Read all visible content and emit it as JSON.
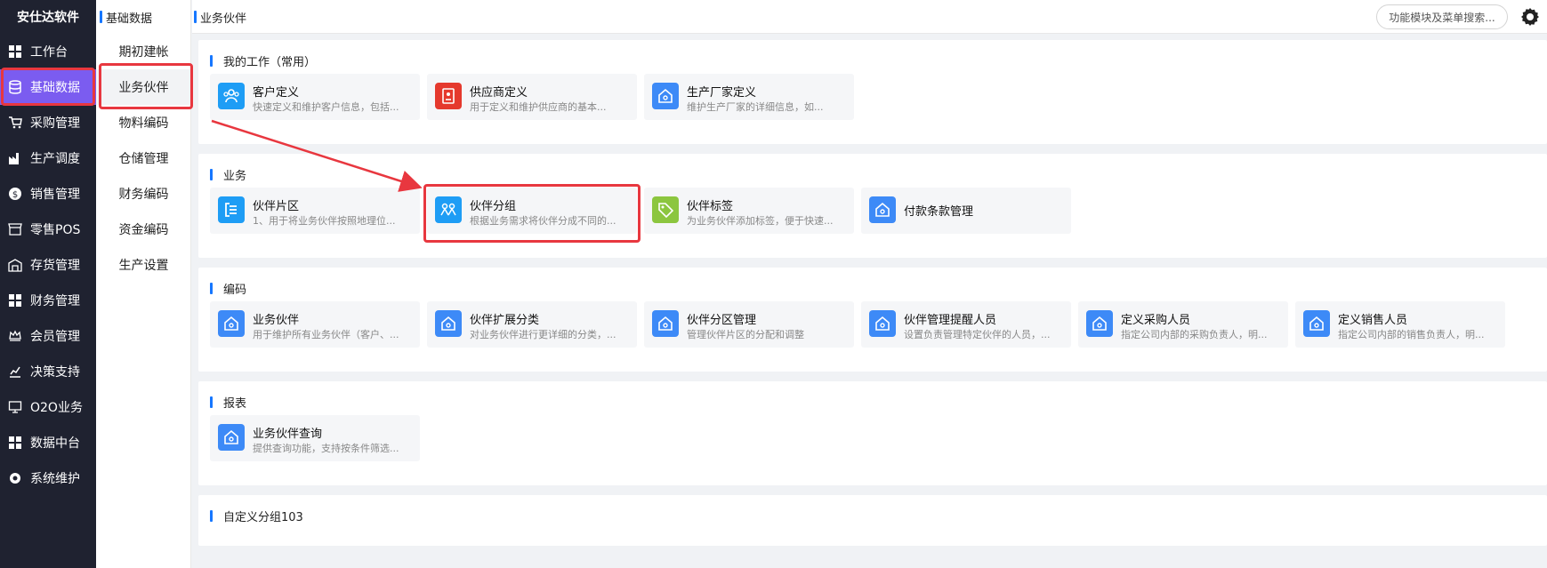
{
  "brand": "安仕达软件",
  "nav": [
    {
      "label": "工作台",
      "icon": "grid-icon"
    },
    {
      "label": "基础数据",
      "icon": "database-icon",
      "active": true
    },
    {
      "label": "采购管理",
      "icon": "cart-icon"
    },
    {
      "label": "生产调度",
      "icon": "factory-icon"
    },
    {
      "label": "销售管理",
      "icon": "sales-icon"
    },
    {
      "label": "零售POS",
      "icon": "store-icon"
    },
    {
      "label": "存货管理",
      "icon": "warehouse-icon"
    },
    {
      "label": "财务管理",
      "icon": "grid-icon"
    },
    {
      "label": "会员管理",
      "icon": "crown-icon"
    },
    {
      "label": "决策支持",
      "icon": "chart-icon"
    },
    {
      "label": "O2O业务",
      "icon": "monitor-icon"
    },
    {
      "label": "数据中台",
      "icon": "grid-icon"
    },
    {
      "label": "系统维护",
      "icon": "gear-icon"
    }
  ],
  "subnav": {
    "title": "基础数据",
    "items": [
      "期初建帐",
      "业务伙伴",
      "物料编码",
      "仓储管理",
      "财务编码",
      "资金编码",
      "生产设置"
    ]
  },
  "breadcrumb": "业务伙伴",
  "search": {
    "placeholder": "功能模块及菜单搜索..."
  },
  "colors": {
    "accent": "#1677ff",
    "nav_bg": "#1f2230",
    "nav_active": "#7b5cf0",
    "highlight": "#e8373f"
  },
  "sections": [
    {
      "title": "我的工作（常用）",
      "cards": [
        {
          "title": "客户定义",
          "desc": "快速定义和维护客户信息，包括...",
          "icon": "customer-icon",
          "color": "#1e9df5"
        },
        {
          "title": "供应商定义",
          "desc": "用于定义和维护供应商的基本...",
          "icon": "supplier-icon",
          "color": "#e5392d"
        },
        {
          "title": "生产厂家定义",
          "desc": "维护生产厂家的详细信息，如...",
          "icon": "home-icon",
          "color": "#3d8af7"
        }
      ]
    },
    {
      "title": "业务",
      "cards": [
        {
          "title": "伙伴片区",
          "desc": "1、用于将业务伙伴按照地理位...",
          "icon": "area-icon",
          "color": "#1e9df5"
        },
        {
          "title": "伙伴分组",
          "desc": "根据业务需求将伙伴分成不同的...",
          "icon": "group-icon",
          "color": "#1e9df5"
        },
        {
          "title": "伙伴标签",
          "desc": "为业务伙伴添加标签，便于快速...",
          "icon": "tag-icon",
          "color": "#8cc63f"
        },
        {
          "title": "付款条款管理",
          "desc": "",
          "icon": "home-icon",
          "color": "#3d8af7"
        }
      ]
    },
    {
      "title": "编码",
      "cards": [
        {
          "title": "业务伙伴",
          "desc": "用于维护所有业务伙伴（客户、...",
          "icon": "home-icon",
          "color": "#3d8af7"
        },
        {
          "title": "伙伴扩展分类",
          "desc": "对业务伙伴进行更详细的分类，...",
          "icon": "home-icon",
          "color": "#3d8af7"
        },
        {
          "title": "伙伴分区管理",
          "desc": "管理伙伴片区的分配和调整",
          "icon": "home-icon",
          "color": "#3d8af7"
        },
        {
          "title": "伙伴管理提醒人员",
          "desc": "设置负责管理特定伙伴的人员，...",
          "icon": "home-icon",
          "color": "#3d8af7"
        },
        {
          "title": "定义采购人员",
          "desc": "指定公司内部的采购负责人，明...",
          "icon": "home-icon",
          "color": "#3d8af7"
        },
        {
          "title": "定义销售人员",
          "desc": "指定公司内部的销售负责人，明...",
          "icon": "home-icon",
          "color": "#3d8af7"
        }
      ]
    },
    {
      "title": "报表",
      "cards": [
        {
          "title": "业务伙伴查询",
          "desc": "提供查询功能，支持按条件筛选...",
          "icon": "home-icon",
          "color": "#3d8af7"
        }
      ]
    },
    {
      "title": "自定义分组103",
      "cards": []
    }
  ]
}
